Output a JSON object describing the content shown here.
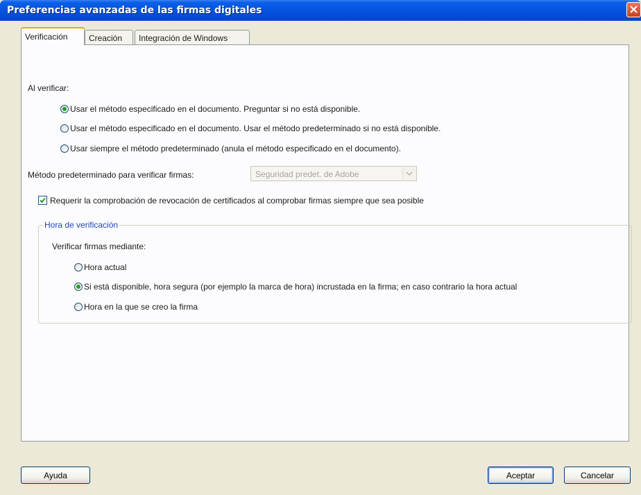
{
  "window": {
    "title": "Preferencias avanzadas de las firmas digitales"
  },
  "tabs": [
    {
      "label": "Verificación",
      "active": true
    },
    {
      "label": "Creación",
      "active": false
    },
    {
      "label": "Integración de Windows",
      "active": false
    }
  ],
  "verification": {
    "heading": "Al verificar:",
    "options": [
      {
        "label": "Usar el método especificado en el documento. Preguntar si no está disponible.",
        "selected": true
      },
      {
        "label": "Usar el método especificado en el documento. Usar el método predeterminado si no está disponible.",
        "selected": false
      },
      {
        "label": "Usar siempre el método predeterminado (anula el método especificado en el documento).",
        "selected": false
      }
    ],
    "default_method_label": "Método predeterminado para verificar firmas:",
    "default_method_value": "Seguridad predet. de Adobe",
    "revocation_check_label": "Requerir la comprobación de revocación de certificados al comprobar firmas siempre que sea posible",
    "revocation_check_checked": true
  },
  "verification_time": {
    "group_title": "Hora de verificación",
    "heading": "Verificar firmas mediante:",
    "options": [
      {
        "label": "Hora actual",
        "selected": false
      },
      {
        "label": "Si está disponible, hora segura (por ejemplo la marca de hora) incrustada en la firma; en caso contrario la hora actual",
        "selected": true
      },
      {
        "label": "Hora en la que se creo la firma",
        "selected": false
      }
    ]
  },
  "buttons": {
    "help": "Ayuda",
    "accept": "Aceptar",
    "cancel": "Cancelar"
  },
  "icons": {
    "close": "close-icon",
    "dropdown": "chevron-down-icon",
    "check": "checkmark-icon"
  },
  "colors": {
    "titlebar": "#0553de",
    "face": "#ece9d8",
    "panel": "#fcfcfe",
    "active_tab_accent": "#f7a500",
    "group_title": "#1f45b5",
    "radio_dot": "#21a121"
  }
}
